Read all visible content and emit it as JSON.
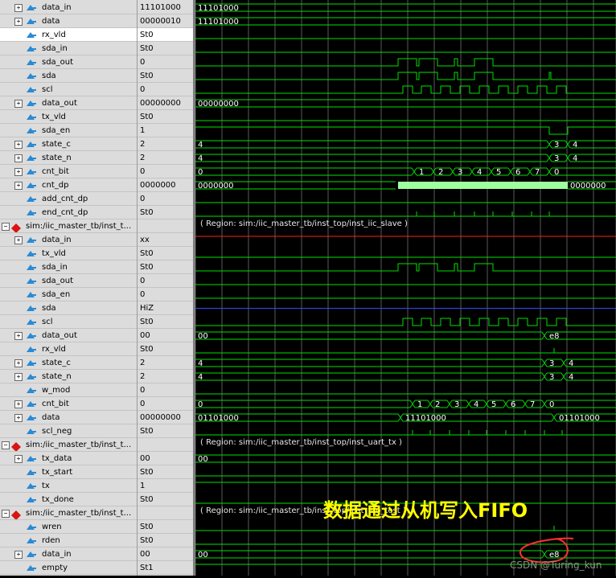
{
  "rows": [
    {
      "name": "data_in",
      "value": "11101000",
      "level": 1,
      "type": "bus"
    },
    {
      "name": "data",
      "value": "00000010",
      "level": 1,
      "type": "bus"
    },
    {
      "name": "rx_vld",
      "value": "St0",
      "level": 1,
      "type": "sig",
      "selected": true
    },
    {
      "name": "sda_in",
      "value": "St0",
      "level": 1,
      "type": "sig"
    },
    {
      "name": "sda_out",
      "value": "0",
      "level": 1,
      "type": "sig"
    },
    {
      "name": "sda",
      "value": "St0",
      "level": 1,
      "type": "sig"
    },
    {
      "name": "scl",
      "value": "0",
      "level": 1,
      "type": "sig"
    },
    {
      "name": "data_out",
      "value": "00000000",
      "level": 1,
      "type": "bus"
    },
    {
      "name": "tx_vld",
      "value": "St0",
      "level": 1,
      "type": "sig"
    },
    {
      "name": "sda_en",
      "value": "1",
      "level": 1,
      "type": "sig"
    },
    {
      "name": "state_c",
      "value": "2",
      "level": 1,
      "type": "bus"
    },
    {
      "name": "state_n",
      "value": "2",
      "level": 1,
      "type": "bus"
    },
    {
      "name": "cnt_bit",
      "value": "0",
      "level": 1,
      "type": "bus"
    },
    {
      "name": "cnt_dp",
      "value": "0000000",
      "level": 1,
      "type": "bus"
    },
    {
      "name": "add_cnt_dp",
      "value": "0",
      "level": 1,
      "type": "sig"
    },
    {
      "name": "end_cnt_dp",
      "value": "St0",
      "level": 1,
      "type": "sig"
    },
    {
      "name": "sim:/iic_master_tb/inst_t...",
      "value": "",
      "level": 0,
      "type": "group"
    },
    {
      "name": "data_in",
      "value": "xx",
      "level": 1,
      "type": "bus"
    },
    {
      "name": "tx_vld",
      "value": "St0",
      "level": 1,
      "type": "sig"
    },
    {
      "name": "sda_in",
      "value": "St0",
      "level": 1,
      "type": "sig"
    },
    {
      "name": "sda_out",
      "value": "0",
      "level": 1,
      "type": "sig"
    },
    {
      "name": "sda_en",
      "value": "0",
      "level": 1,
      "type": "sig"
    },
    {
      "name": "sda",
      "value": "HiZ",
      "level": 1,
      "type": "sig"
    },
    {
      "name": "scl",
      "value": "St0",
      "level": 1,
      "type": "sig"
    },
    {
      "name": "data_out",
      "value": "00",
      "level": 1,
      "type": "bus"
    },
    {
      "name": "rx_vld",
      "value": "St0",
      "level": 1,
      "type": "sig"
    },
    {
      "name": "state_c",
      "value": "2",
      "level": 1,
      "type": "bus"
    },
    {
      "name": "state_n",
      "value": "2",
      "level": 1,
      "type": "bus"
    },
    {
      "name": "w_mod",
      "value": "0",
      "level": 1,
      "type": "sig"
    },
    {
      "name": "cnt_bit",
      "value": "0",
      "level": 1,
      "type": "bus"
    },
    {
      "name": "data",
      "value": "00000000",
      "level": 1,
      "type": "bus"
    },
    {
      "name": "scl_neg",
      "value": "St0",
      "level": 1,
      "type": "sig"
    },
    {
      "name": "sim:/iic_master_tb/inst_t...",
      "value": "",
      "level": 0,
      "type": "group"
    },
    {
      "name": "tx_data",
      "value": "00",
      "level": 1,
      "type": "bus"
    },
    {
      "name": "tx_start",
      "value": "St0",
      "level": 1,
      "type": "sig"
    },
    {
      "name": "tx",
      "value": "1",
      "level": 1,
      "type": "sig"
    },
    {
      "name": "tx_done",
      "value": "St0",
      "level": 1,
      "type": "sig"
    },
    {
      "name": "sim:/iic_master_tb/inst_t...",
      "value": "",
      "level": 0,
      "type": "group"
    },
    {
      "name": "wren",
      "value": "St0",
      "level": 1,
      "type": "sig"
    },
    {
      "name": "rden",
      "value": "St0",
      "level": 1,
      "type": "sig"
    },
    {
      "name": "data_in",
      "value": "00",
      "level": 1,
      "type": "bus"
    },
    {
      "name": "empty",
      "value": "St1",
      "level": 1,
      "type": "sig"
    }
  ],
  "regions": [
    "( Region: sim:/iic_master_tb/inst_top/inst_iic_slave )",
    "( Region: sim:/iic_master_tb/inst_top/inst_uart_tx )",
    "( Region: sim:/iic_master_tb/inst_top/inst_fifo_test )"
  ],
  "bus_labels": {
    "m_data_in": "11101000",
    "m_data": "11101000",
    "m_data_out": "00000000",
    "m_state_c": [
      "4",
      "3",
      "4"
    ],
    "m_state_n": [
      "4",
      "3",
      "4"
    ],
    "m_cnt_bit": [
      "0",
      "1",
      "2",
      "3",
      "4",
      "5",
      "6",
      "7",
      "0"
    ],
    "m_cnt_dp": [
      "0000000",
      "0000000"
    ],
    "s_data_out": [
      "00",
      "e8"
    ],
    "s_state_c": [
      "4",
      "3",
      "4"
    ],
    "s_state_n": [
      "4",
      "3",
      "4"
    ],
    "s_cnt_bit": [
      "0",
      "1",
      "2",
      "3",
      "4",
      "5",
      "6",
      "7",
      "0"
    ],
    "s_data": [
      "01101000",
      "11101000",
      "01101000"
    ],
    "u_tx_data": "00",
    "f_data_in": [
      "00",
      "e8"
    ]
  },
  "annotation": "数据通过从机写入FIFO",
  "watermark": "CSDN @Turing_kun",
  "colors": {
    "wave": "#00e000",
    "bus_hi": "#9fff9f",
    "red": "#ff2020",
    "blue": "#2a4cff",
    "cursor": "#ff3030"
  }
}
